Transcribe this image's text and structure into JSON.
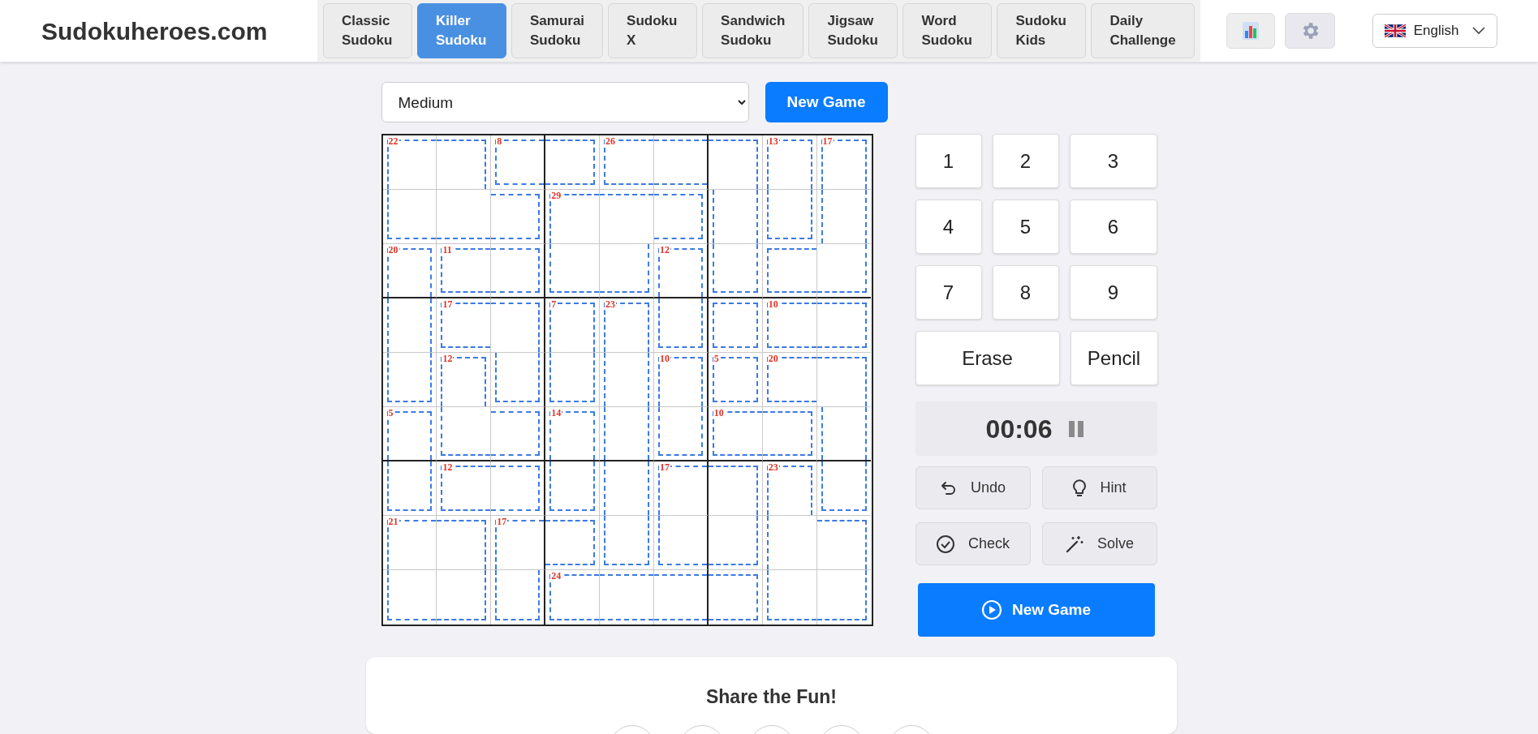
{
  "header": {
    "logo": "Sudokuheroes.com",
    "tabs": [
      {
        "label": "Classic Sudoku",
        "selected": false
      },
      {
        "label": "Killer Sudoku",
        "selected": true
      },
      {
        "label": "Samurai Sudoku",
        "selected": false
      },
      {
        "label": "Sudoku X",
        "selected": false
      },
      {
        "label": "Sandwich Sudoku",
        "selected": false
      },
      {
        "label": "Jigsaw Sudoku",
        "selected": false
      },
      {
        "label": "Word Sudoku",
        "selected": false
      },
      {
        "label": "Sudoku Kids",
        "selected": false
      },
      {
        "label": "Daily Challenge",
        "selected": false
      }
    ],
    "language": "English"
  },
  "controls": {
    "difficulty": "Medium",
    "new_game": "New Game"
  },
  "puzzle": {
    "rows": [
      [
        {
          "sum": "22",
          "top": true,
          "right": false,
          "bottom": false,
          "left": true
        },
        {
          "top": true,
          "right": true,
          "bottom": false,
          "left": false
        },
        {
          "sum": "8",
          "top": true,
          "right": false,
          "bottom": true,
          "left": true
        },
        {
          "top": true,
          "right": true,
          "bottom": true,
          "left": false
        },
        {
          "sum": "26",
          "top": true,
          "right": false,
          "bottom": true,
          "left": true
        },
        {
          "top": true,
          "right": false,
          "bottom": true,
          "left": false
        },
        {
          "top": true,
          "right": true,
          "bottom": false,
          "left": false
        },
        {
          "sum": "13",
          "top": true,
          "right": true,
          "bottom": false,
          "left": true
        },
        {
          "sum": "17",
          "top": true,
          "right": true,
          "bottom": false,
          "left": true
        }
      ],
      [
        {
          "top": false,
          "right": false,
          "bottom": true,
          "left": true
        },
        {
          "top": false,
          "right": false,
          "bottom": true,
          "left": false
        },
        {
          "top": true,
          "right": true,
          "bottom": true,
          "left": false
        },
        {
          "sum": "29",
          "top": true,
          "right": false,
          "bottom": false,
          "left": true
        },
        {
          "top": true,
          "right": false,
          "bottom": false,
          "left": false
        },
        {
          "top": true,
          "right": true,
          "bottom": true,
          "left": false
        },
        {
          "top": false,
          "right": true,
          "bottom": false,
          "left": true
        },
        {
          "top": false,
          "right": true,
          "bottom": true,
          "left": true
        },
        {
          "top": false,
          "right": true,
          "bottom": false,
          "left": true
        }
      ],
      [
        {
          "sum": "20",
          "top": true,
          "right": true,
          "bottom": false,
          "left": true
        },
        {
          "sum": "11",
          "top": true,
          "right": false,
          "bottom": true,
          "left": true
        },
        {
          "top": true,
          "right": true,
          "bottom": true,
          "left": false
        },
        {
          "top": false,
          "right": false,
          "bottom": true,
          "left": true
        },
        {
          "top": false,
          "right": true,
          "bottom": true,
          "left": false
        },
        {
          "sum": "12",
          "top": true,
          "right": true,
          "bottom": false,
          "left": true
        },
        {
          "top": false,
          "right": true,
          "bottom": true,
          "left": true
        },
        {
          "top": true,
          "right": false,
          "bottom": true,
          "left": true
        },
        {
          "top": false,
          "right": true,
          "bottom": true,
          "left": false
        }
      ],
      [
        {
          "top": false,
          "right": true,
          "bottom": false,
          "left": true
        },
        {
          "sum": "17",
          "top": true,
          "right": false,
          "bottom": true,
          "left": true
        },
        {
          "top": true,
          "right": true,
          "bottom": false,
          "left": false
        },
        {
          "sum": "7",
          "top": true,
          "right": true,
          "bottom": false,
          "left": true
        },
        {
          "sum": "23",
          "top": true,
          "right": true,
          "bottom": false,
          "left": true
        },
        {
          "top": false,
          "right": true,
          "bottom": true,
          "left": true
        },
        {
          "top": true,
          "right": true,
          "bottom": true,
          "left": true
        },
        {
          "sum": "10",
          "top": true,
          "right": false,
          "bottom": true,
          "left": true
        },
        {
          "top": true,
          "right": true,
          "bottom": true,
          "left": false
        }
      ],
      [
        {
          "top": false,
          "right": true,
          "bottom": true,
          "left": true
        },
        {
          "sum": "12",
          "top": true,
          "right": true,
          "bottom": false,
          "left": true
        },
        {
          "top": false,
          "right": true,
          "bottom": true,
          "left": true
        },
        {
          "top": false,
          "right": true,
          "bottom": true,
          "left": true
        },
        {
          "top": false,
          "right": true,
          "bottom": false,
          "left": true
        },
        {
          "sum": "10",
          "top": true,
          "right": true,
          "bottom": false,
          "left": true
        },
        {
          "sum": "5",
          "top": true,
          "right": true,
          "bottom": true,
          "left": true
        },
        {
          "sum": "20",
          "top": true,
          "right": false,
          "bottom": true,
          "left": true
        },
        {
          "top": true,
          "right": true,
          "bottom": false,
          "left": false
        }
      ],
      [
        {
          "sum": "5",
          "top": true,
          "right": true,
          "bottom": false,
          "left": true
        },
        {
          "top": false,
          "right": false,
          "bottom": true,
          "left": true
        },
        {
          "top": true,
          "right": true,
          "bottom": true,
          "left": false
        },
        {
          "sum": "14",
          "top": true,
          "right": true,
          "bottom": false,
          "left": true
        },
        {
          "top": false,
          "right": true,
          "bottom": false,
          "left": true
        },
        {
          "top": false,
          "right": true,
          "bottom": true,
          "left": true
        },
        {
          "sum": "10",
          "top": true,
          "right": false,
          "bottom": true,
          "left": true
        },
        {
          "top": true,
          "right": true,
          "bottom": true,
          "left": false
        },
        {
          "top": false,
          "right": true,
          "bottom": false,
          "left": true
        }
      ],
      [
        {
          "top": false,
          "right": true,
          "bottom": true,
          "left": true
        },
        {
          "sum": "12",
          "top": true,
          "right": false,
          "bottom": true,
          "left": true
        },
        {
          "top": true,
          "right": true,
          "bottom": true,
          "left": false
        },
        {
          "top": false,
          "right": true,
          "bottom": true,
          "left": true
        },
        {
          "top": false,
          "right": true,
          "bottom": false,
          "left": true
        },
        {
          "sum": "17",
          "top": true,
          "right": false,
          "bottom": false,
          "left": true
        },
        {
          "top": true,
          "right": true,
          "bottom": false,
          "left": false
        },
        {
          "sum": "23",
          "top": true,
          "right": true,
          "bottom": false,
          "left": true
        },
        {
          "top": false,
          "right": true,
          "bottom": true,
          "left": true
        }
      ],
      [
        {
          "sum": "21",
          "top": true,
          "right": false,
          "bottom": false,
          "left": true
        },
        {
          "top": true,
          "right": true,
          "bottom": false,
          "left": false
        },
        {
          "sum": "17",
          "top": true,
          "right": false,
          "bottom": false,
          "left": true
        },
        {
          "top": true,
          "right": true,
          "bottom": true,
          "left": false
        },
        {
          "top": false,
          "right": true,
          "bottom": true,
          "left": true
        },
        {
          "top": false,
          "right": false,
          "bottom": true,
          "left": true
        },
        {
          "top": false,
          "right": true,
          "bottom": true,
          "left": false
        },
        {
          "top": false,
          "right": false,
          "bottom": false,
          "left": true
        },
        {
          "top": true,
          "right": true,
          "bottom": false,
          "left": false
        }
      ],
      [
        {
          "top": false,
          "right": false,
          "bottom": true,
          "left": true
        },
        {
          "top": false,
          "right": true,
          "bottom": true,
          "left": false
        },
        {
          "top": false,
          "right": true,
          "bottom": true,
          "left": true
        },
        {
          "sum": "24",
          "top": true,
          "right": false,
          "bottom": true,
          "left": true
        },
        {
          "top": true,
          "right": false,
          "bottom": true,
          "left": false
        },
        {
          "top": true,
          "right": false,
          "bottom": true,
          "left": false
        },
        {
          "top": true,
          "right": true,
          "bottom": true,
          "left": false
        },
        {
          "top": false,
          "right": false,
          "bottom": true,
          "left": true
        },
        {
          "top": false,
          "right": true,
          "bottom": true,
          "left": false
        }
      ]
    ]
  },
  "keypad": [
    "1",
    "2",
    "3",
    "4",
    "5",
    "6",
    "7",
    "8",
    "9"
  ],
  "erase": "Erase",
  "pencil": "Pencil",
  "timer": "00:06",
  "actions": [
    {
      "kind": "undo",
      "label": "Undo"
    },
    {
      "kind": "hint",
      "label": "Hint"
    },
    {
      "kind": "check",
      "label": "Check"
    },
    {
      "kind": "solve",
      "label": "Solve"
    }
  ],
  "big_button": "New Game",
  "share": {
    "title": "Share the Fun!"
  }
}
